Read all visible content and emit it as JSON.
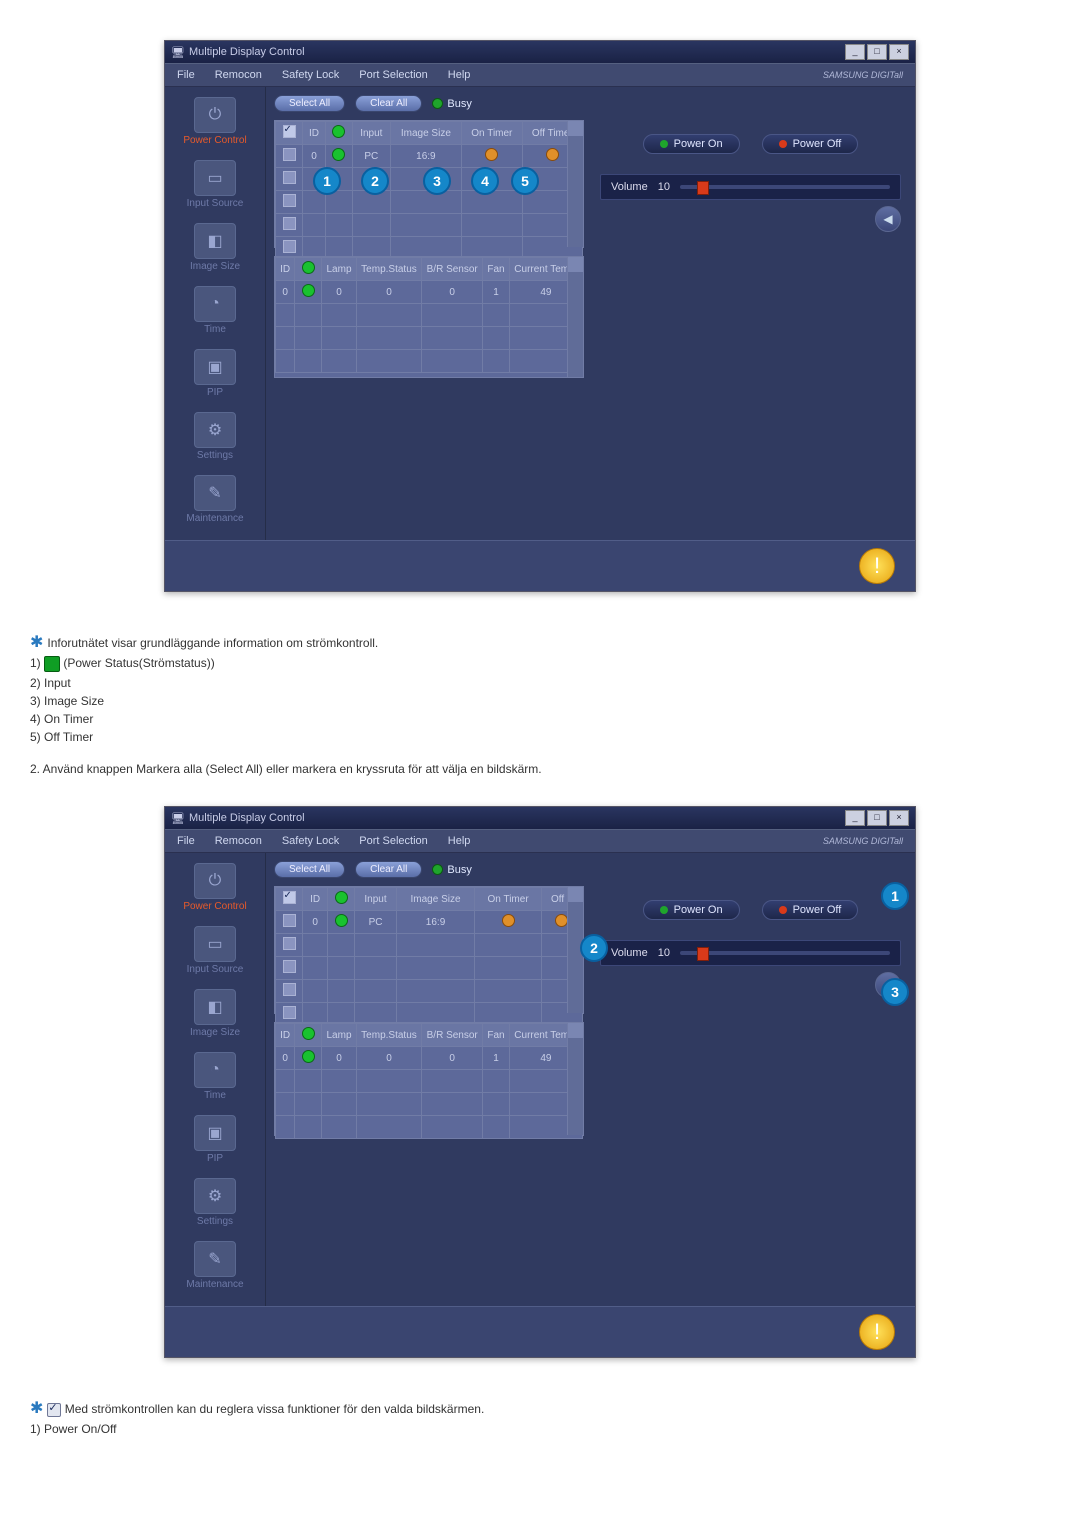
{
  "window": {
    "title": "Multiple Display Control",
    "menu": [
      "File",
      "Remocon",
      "Safety Lock",
      "Port Selection",
      "Help"
    ],
    "brand": "SAMSUNG DIGITall"
  },
  "sidebar": {
    "items": [
      {
        "label": "Power Control",
        "icon": "⏻"
      },
      {
        "label": "Input Source",
        "icon": "▭"
      },
      {
        "label": "Image Size",
        "icon": "◧"
      },
      {
        "label": "Time",
        "icon": "◔"
      },
      {
        "label": "PIP",
        "icon": "▣"
      },
      {
        "label": "Settings",
        "icon": "⚙"
      },
      {
        "label": "Maintenance",
        "icon": "✎"
      }
    ]
  },
  "toolbar": {
    "select_all": "Select All",
    "clear_all": "Clear All",
    "busy": "Busy"
  },
  "grid1": {
    "headers": [
      "",
      "ID",
      "",
      "Input",
      "Image Size",
      "On Timer",
      "Off Timer"
    ],
    "row": {
      "id": "0",
      "input": "PC",
      "image_size": "16:9"
    }
  },
  "grid2": {
    "headers": [
      "ID",
      "",
      "Lamp",
      "Temp.Status",
      "B/R Sensor",
      "Fan",
      "Current Temp."
    ],
    "row": {
      "id": "0",
      "lamp": "0",
      "temp": "0",
      "br": "0",
      "fan": "1",
      "ctemp": "49"
    }
  },
  "right": {
    "power_on": "Power On",
    "power_off": "Power Off",
    "volume_label": "Volume",
    "volume_value": "10"
  },
  "grid1b_headers": [
    "",
    "ID",
    "",
    "Input",
    "Image Size",
    "On Timer",
    "Off T"
  ],
  "prose": {
    "p1": "Inforutnätet visar grundläggande information om strömkontroll.",
    "l1": "1) ",
    "l1suffix": " (Power Status(Strömstatus))",
    "l2": "2) Input",
    "l3": "3) Image Size",
    "l4": "4) On Timer",
    "l5": "5) Off Timer",
    "p2": "2.  Använd knappen Markera alla (Select All) eller markera en kryssruta för att välja en bildskärm.",
    "p3": " Med strömkontrollen kan du reglera vissa funktioner för den valda bildskärmen.",
    "p4": "1)  Power On/Off"
  },
  "callouts1": [
    "1",
    "2",
    "3",
    "4",
    "5"
  ],
  "callouts2": [
    "1",
    "2",
    "3"
  ]
}
